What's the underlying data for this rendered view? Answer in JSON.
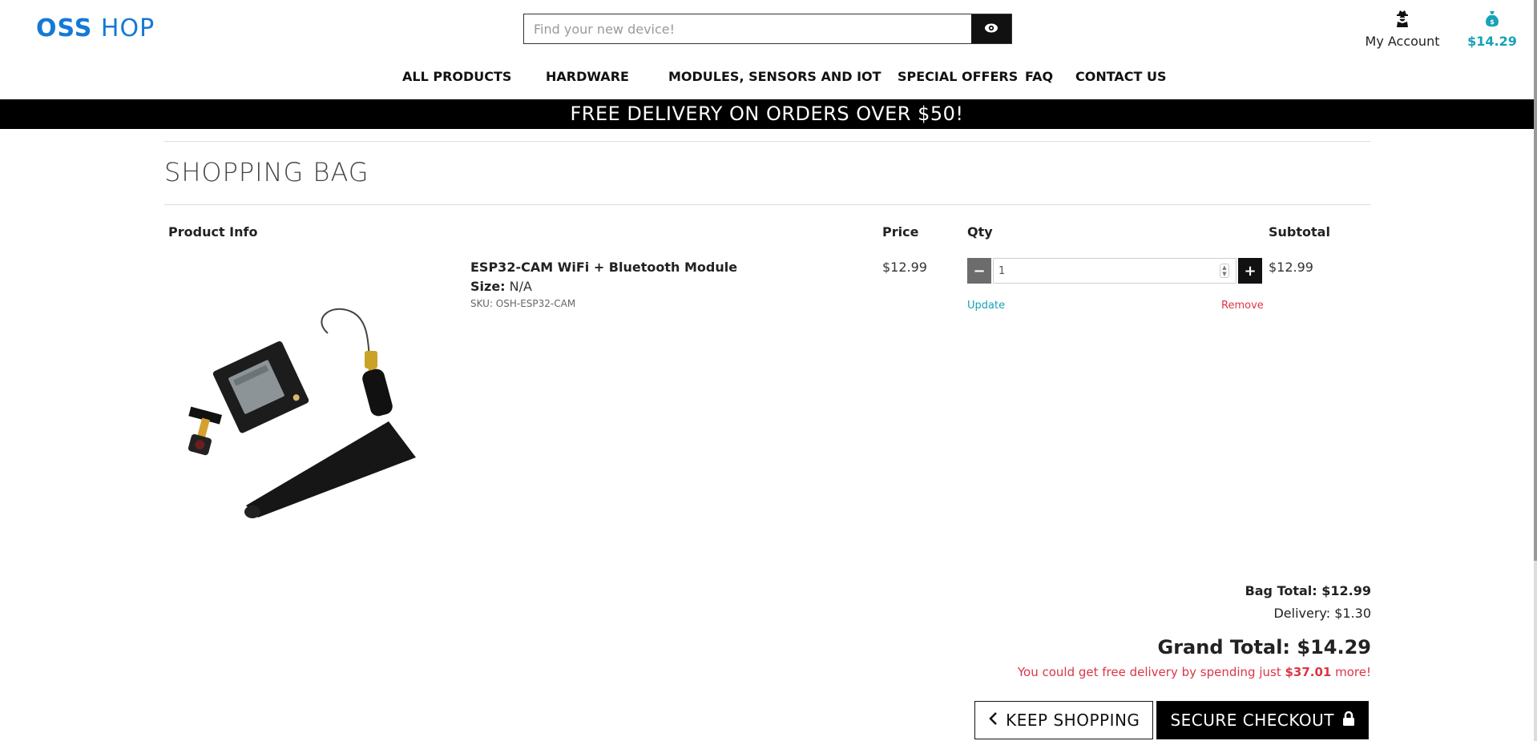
{
  "header": {
    "logo_part1": "OSS",
    "logo_part2": "HOP",
    "search_placeholder": "Find your new device!",
    "search_icon": "eye-icon",
    "account_icon": "user-secret-icon",
    "account_label": "My Account",
    "bag_icon": "money-bag-icon",
    "bag_total": "$14.29"
  },
  "nav": {
    "items": [
      "ALL PRODUCTS",
      "HARDWARE",
      "MODULES, SENSORS AND IOT",
      "SPECIAL OFFERS",
      "FAQ",
      "CONTACT US"
    ]
  },
  "promo": "FREE DELIVERY ON ORDERS OVER $50!",
  "page": {
    "title": "SHOPPING BAG"
  },
  "table": {
    "headers": [
      "Product Info",
      "Price",
      "Qty",
      "Subtotal"
    ],
    "rows": [
      {
        "name": "ESP32-CAM WiFi + Bluetooth Module",
        "size_label": "Size:",
        "size_value": "N/A",
        "sku": "SKU: OSH-ESP32-CAM",
        "price": "$12.99",
        "qty": "1",
        "qty_minus": "−",
        "qty_plus": "+",
        "update_label": "Update",
        "remove_label": "Remove",
        "subtotal": "$12.99"
      }
    ]
  },
  "totals": {
    "bag_total": "Bag Total: $12.99",
    "delivery": "Delivery: $1.30",
    "grand_total": "Grand Total: $14.29",
    "free_msg_prefix": "You could get free delivery by spending just ",
    "free_msg_amount": "$37.01",
    "free_msg_suffix": " more!"
  },
  "buttons": {
    "keep_shopping": "KEEP SHOPPING",
    "secure_checkout": "SECURE CHECKOUT"
  },
  "colors": {
    "brand_blue": "#1479d6",
    "teal": "#17a2b8",
    "danger_red": "#dc3545",
    "black": "#000000"
  }
}
